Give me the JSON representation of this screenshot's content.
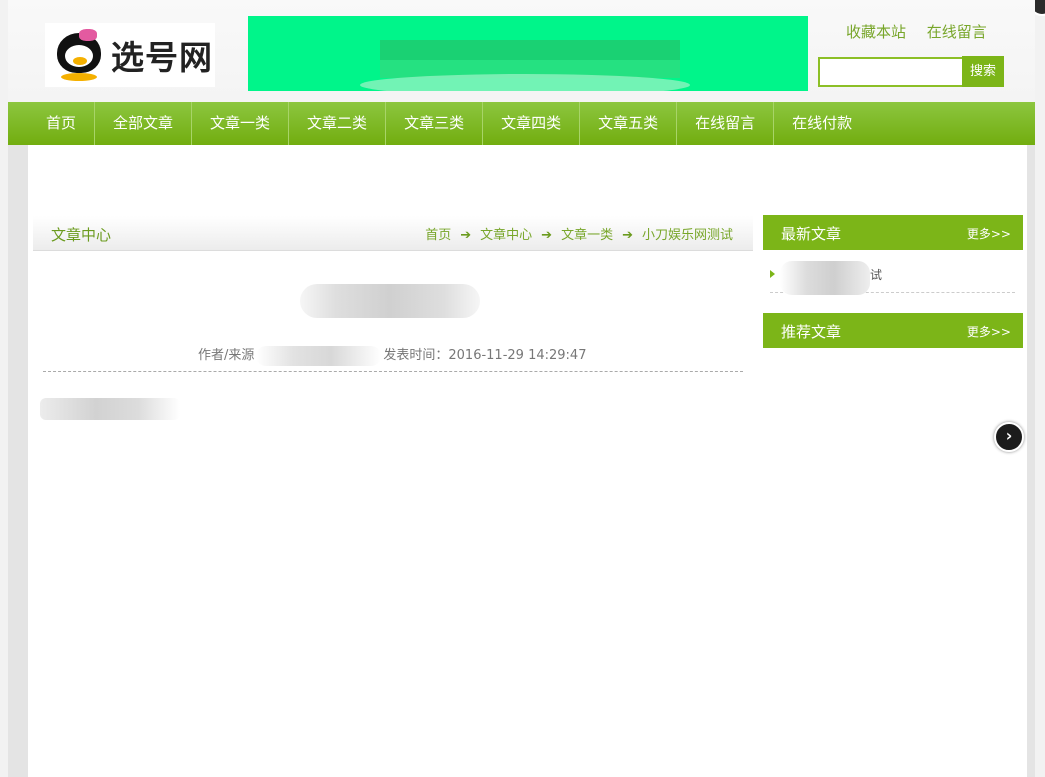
{
  "header": {
    "logo_text": "选号网",
    "top_links": [
      "收藏本站",
      "在线留言"
    ],
    "search_button": "搜索",
    "search_value": ""
  },
  "nav": {
    "items": [
      "首页",
      "全部文章",
      "文章一类",
      "文章二类",
      "文章三类",
      "文章四类",
      "文章五类",
      "在线留言",
      "在线付款"
    ]
  },
  "article": {
    "section_title": "文章中心",
    "breadcrumb": [
      "首页",
      "文章中心",
      "文章一类",
      "小刀娱乐网测试"
    ],
    "breadcrumb_arrow": "➔",
    "meta_author_label": "作者/来源",
    "meta_time": "发表时间：2016-11-29 14:29:47"
  },
  "sidebar": {
    "latest": {
      "title": "最新文章",
      "more": "更多>>",
      "items": [
        {
          "tail": "试"
        }
      ]
    },
    "recommended": {
      "title": "推荐文章",
      "more": "更多>>"
    }
  },
  "float_button_glyph": "›",
  "colors": {
    "accent": "#7cb518",
    "link": "#78a62a",
    "banner": "#00f58a"
  }
}
